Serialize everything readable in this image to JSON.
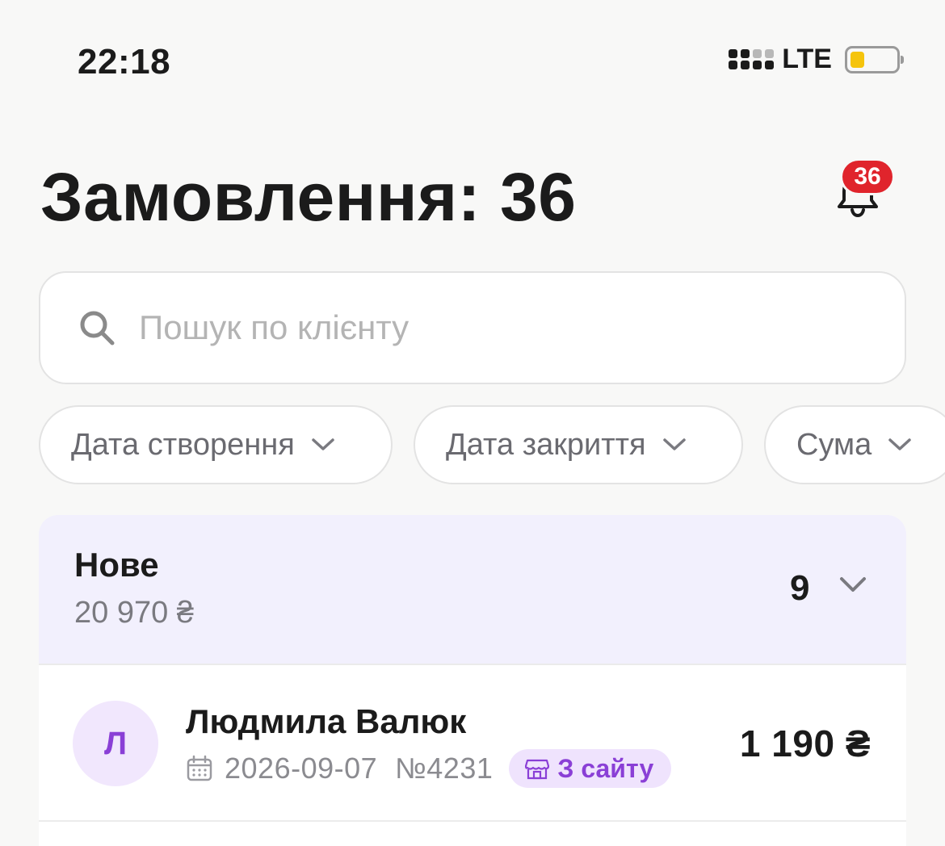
{
  "status_bar": {
    "time": "22:18",
    "network": "LTE",
    "battery_level": 0.2,
    "battery_color": "#f5c40c"
  },
  "header": {
    "title": "Замовлення: 36",
    "notifications_count": "36",
    "badge_color": "#e0242c",
    "bell_icon": "bell-icon"
  },
  "search": {
    "placeholder": "Пошук по клієнту",
    "value": "",
    "icon": "search-icon"
  },
  "filters": [
    {
      "label": "Дата створення"
    },
    {
      "label": "Дата закриття"
    },
    {
      "label": "Сума"
    }
  ],
  "group": {
    "title": "Нове",
    "sum": "20 970 ₴",
    "count": "9",
    "background": "#f2f0fd"
  },
  "orders": [
    {
      "avatar_letter": "Л",
      "client": "Людмила Валюк",
      "date": "2026-09-07",
      "number": "№4231",
      "source": "З сайту",
      "price": "1 190 ₴",
      "accent": "#8a3fd6"
    }
  ]
}
